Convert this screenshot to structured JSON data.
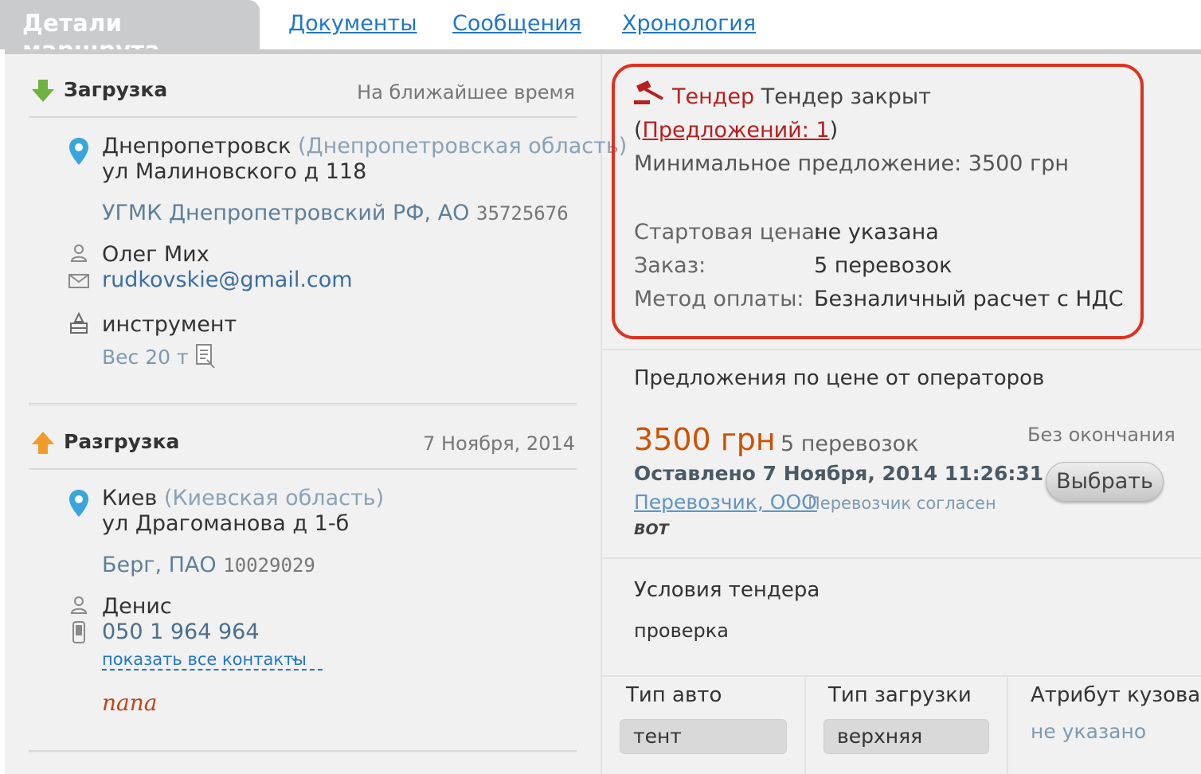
{
  "tabs": {
    "active": "Детали маршрута",
    "documents": "Документы",
    "messages": "Сообщения",
    "history": "Хронология"
  },
  "loading": {
    "title": "Загрузка",
    "when": "На ближайшее время",
    "city": "Днепропетровск",
    "region": "(Днепропетровская область)",
    "street": "ул Малиновского д 118",
    "company": "УГМК Днепропетровский РФ, АО",
    "company_code": "35725676",
    "contact_name": "Олег Мих",
    "contact_email": "rudkovskie@gmail.com",
    "cargo": "инструмент",
    "weight": "Вес 20 т"
  },
  "unloading": {
    "title": "Разгрузка",
    "date": "7 Ноября, 2014",
    "city": "Киев",
    "region": "(Киевская область)",
    "street": "ул Драгоманова д 1-б",
    "company": "Берг, ПАО",
    "company_code": "10029029",
    "contact_name": "Денис",
    "contact_phone": "050 1 964 964",
    "show_contacts": "показать все контакты",
    "note": "папа"
  },
  "tender": {
    "label": "Тендер",
    "status": "Тендер закрыт",
    "offers_open": "(",
    "offers_link": "Предложений: 1",
    "offers_close": ")",
    "min_offer": "Минимальное предложение: 3500 грн",
    "start_price_label": "Стартовая цена:",
    "start_price_value": "не указана",
    "order_label": "Заказ:",
    "order_value": "5 перевозок",
    "payment_label": "Метод оплаты:",
    "payment_value": "Безналичный расчет с НДС"
  },
  "offers": {
    "title": "Предложения по цене от операторов",
    "price": "3500 грн",
    "count": "5 перевозок",
    "end": "Без окончания",
    "left_at": "Оставлено 7 Ноября, 2014 11:26:31",
    "carrier_link": "Перевозчик, ООО",
    "carrier_status": "Перевозчик согласен",
    "bot": "BOT",
    "select_button": "Выбрать"
  },
  "conditions": {
    "title": "Условия тендера",
    "text": "проверка"
  },
  "vehicle": {
    "type_label": "Тип авто",
    "type_value": "тент",
    "load_label": "Тип загрузки",
    "load_value": "верхняя",
    "body_label": "Атрибут кузова",
    "body_value": "не указано"
  },
  "colors": {
    "accent": "#2176c8",
    "tender_border": "#e0301e",
    "price": "#cc5200",
    "tender_red": "#b81f1f"
  }
}
